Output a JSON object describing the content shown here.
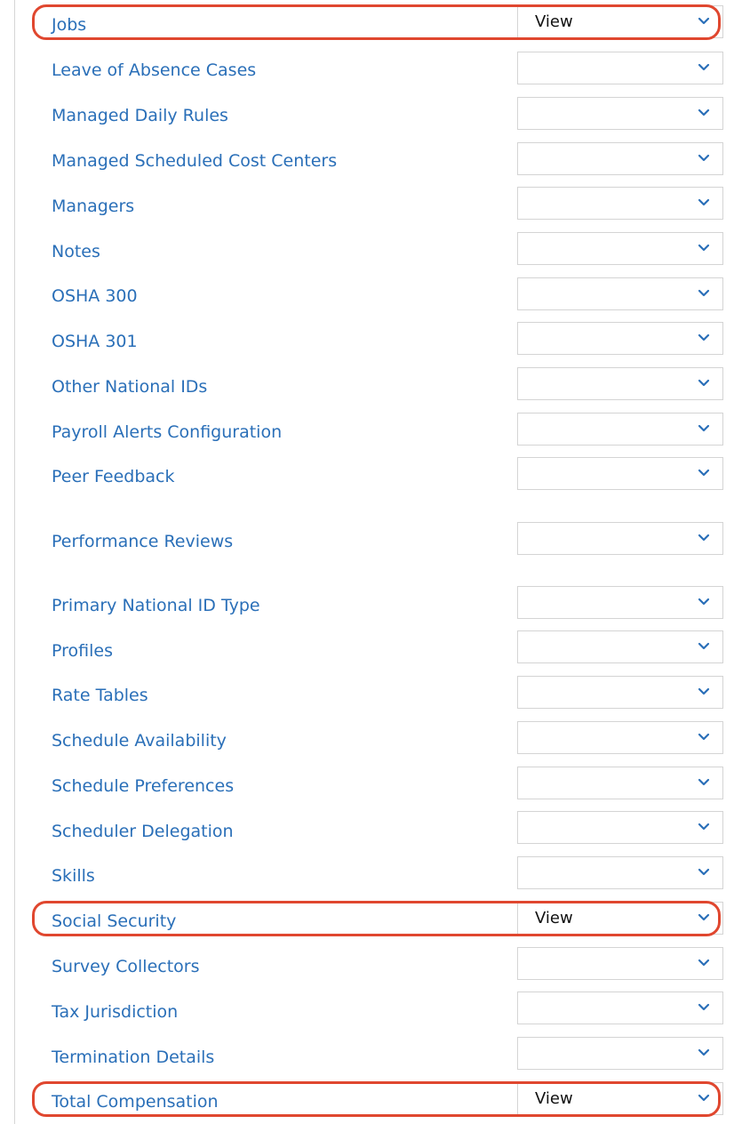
{
  "accent_link_color": "#2a6fb8",
  "highlight_color": "#e0472f",
  "rows": [
    {
      "label": "Jobs",
      "value": "View",
      "highlighted": true
    },
    {
      "label": "Leave of Absence Cases",
      "value": ""
    },
    {
      "label": "Managed Daily Rules",
      "value": ""
    },
    {
      "label": "Managed Scheduled Cost Centers",
      "value": ""
    },
    {
      "label": "Managers",
      "value": ""
    },
    {
      "label": "Notes",
      "value": ""
    },
    {
      "label": "OSHA 300",
      "value": ""
    },
    {
      "label": "OSHA 301",
      "value": ""
    },
    {
      "label": "Other National IDs",
      "value": ""
    },
    {
      "label": "Payroll Alerts Configuration",
      "value": ""
    },
    {
      "label": "Peer Feedback",
      "value": ""
    },
    {
      "label": "Performance Reviews",
      "value": ""
    },
    {
      "label": "Primary National ID Type",
      "value": ""
    },
    {
      "label": "Profiles",
      "value": ""
    },
    {
      "label": "Rate Tables",
      "value": ""
    },
    {
      "label": "Schedule Availability",
      "value": ""
    },
    {
      "label": "Schedule Preferences",
      "value": ""
    },
    {
      "label": "Scheduler Delegation",
      "value": ""
    },
    {
      "label": "Skills",
      "value": ""
    },
    {
      "label": "Social Security",
      "value": "View",
      "highlighted": true
    },
    {
      "label": "Survey Collectors",
      "value": ""
    },
    {
      "label": "Tax Jurisdiction",
      "value": ""
    },
    {
      "label": "Termination Details",
      "value": ""
    },
    {
      "label": "Total Compensation",
      "value": "View",
      "highlighted": true
    }
  ]
}
